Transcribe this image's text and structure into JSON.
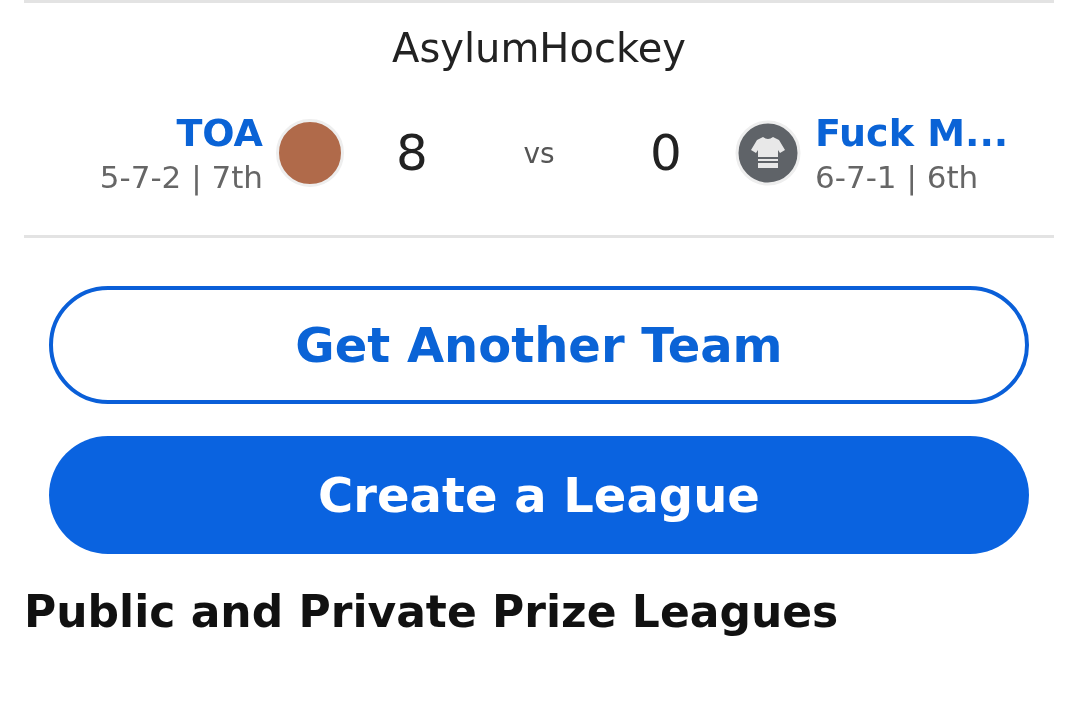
{
  "league_name": "AsylumHockey",
  "matchup": {
    "home": {
      "name": "TOA",
      "record": "5-7-2 | 7th",
      "score": "8"
    },
    "separator": "vs",
    "away": {
      "name": "Fuck M...",
      "record": "6-7-1 | 6th",
      "score": "0"
    }
  },
  "buttons": [
    {
      "label": "Get Another Team",
      "kind": "outline"
    },
    {
      "label": "Create a League",
      "kind": "filled"
    }
  ],
  "section_title": "Public and Private Prize Leagues"
}
